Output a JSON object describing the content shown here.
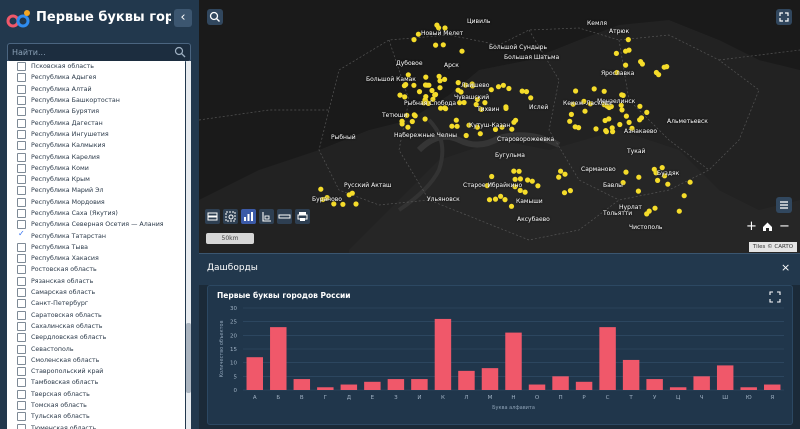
{
  "sidebar": {
    "title": "Первые буквы городо...",
    "search_placeholder": "Найти...",
    "items": [
      {
        "label": "Псковская область",
        "checked": false
      },
      {
        "label": "Республика Адыгея",
        "checked": false
      },
      {
        "label": "Республика Алтай",
        "checked": false
      },
      {
        "label": "Республика Башкортостан",
        "checked": false
      },
      {
        "label": "Республика Бурятия",
        "checked": false
      },
      {
        "label": "Республика Дагестан",
        "checked": false
      },
      {
        "label": "Республика Ингушетия",
        "checked": false
      },
      {
        "label": "Республика Калмыкия",
        "checked": false
      },
      {
        "label": "Республика Карелия",
        "checked": false
      },
      {
        "label": "Республика Коми",
        "checked": false
      },
      {
        "label": "Республика Крым",
        "checked": false
      },
      {
        "label": "Республика Марий Эл",
        "checked": false
      },
      {
        "label": "Республика Мордовия",
        "checked": false
      },
      {
        "label": "Республика Саха (Якутия)",
        "checked": false
      },
      {
        "label": "Республика Северная Осетия — Алания",
        "checked": false
      },
      {
        "label": "Республика Татарстан",
        "checked": true
      },
      {
        "label": "Республика Тыва",
        "checked": false
      },
      {
        "label": "Республика Хакасия",
        "checked": false
      },
      {
        "label": "Ростовская область",
        "checked": false
      },
      {
        "label": "Рязанская область",
        "checked": false
      },
      {
        "label": "Самарская область",
        "checked": false
      },
      {
        "label": "Санкт-Петербург",
        "checked": false
      },
      {
        "label": "Саратовская область",
        "checked": false
      },
      {
        "label": "Сахалинская область",
        "checked": false
      },
      {
        "label": "Свердловская область",
        "checked": false
      },
      {
        "label": "Севастополь",
        "checked": false
      },
      {
        "label": "Смоленская область",
        "checked": false
      },
      {
        "label": "Ставропольский край",
        "checked": false
      },
      {
        "label": "Тамбовская область",
        "checked": false
      },
      {
        "label": "Тверская область",
        "checked": false
      },
      {
        "label": "Томская область",
        "checked": false
      },
      {
        "label": "Тульская область",
        "checked": false
      },
      {
        "label": "Тюменская область",
        "checked": false
      }
    ]
  },
  "map": {
    "scale_label": "50km",
    "attribution": "Tiles © CARTO",
    "point_color": "#f5dc2a",
    "cities": [
      "Цивиль",
      "Новый Мелет",
      "Кемля",
      "Большой Сундырь",
      "Большая Шатьма",
      "Атрюк",
      "Дубовое",
      "Ярославка",
      "Большой Камак",
      "Арск",
      "Лаишево",
      "Чувашский",
      "Рыбная Слобода",
      "Тетюши",
      "Тихвин",
      "Ислей",
      "Кутуш-Казан",
      "Кекеж-Ласкова",
      "Мензелинск",
      "Рыбный",
      "Набережные Челны",
      "Азнакаево",
      "Альметьевск",
      "Староворожеевка",
      "Бугульма",
      "Тукай",
      "Сарманово",
      "Буздяк",
      "Русский Акташ",
      "Бавлы",
      "Старое Ибрайкино",
      "Камыши",
      "Тольятти",
      "Бураново",
      "Аксубаево",
      "Ульяновск",
      "Чистополь",
      "Нурлат"
    ],
    "tools_icons": [
      "layers-icon",
      "select-icon",
      "chart-icon",
      "filter-icon",
      "ruler-icon",
      "print-icon"
    ],
    "icons": {
      "search": "search-icon",
      "fullscreen": "fullscreen-icon",
      "list": "list-icon",
      "zoom_in": "plus-icon",
      "home": "home-icon",
      "zoom_out": "minus-icon"
    }
  },
  "dashboard": {
    "header_title": "Дашборды",
    "close_label": "×",
    "bar_color": "#f0586a"
  },
  "chart_data": {
    "type": "bar",
    "title": "Первые буквы городов России",
    "xlabel": "Буква алфавита",
    "ylabel": "Количество объектов",
    "ylim": [
      0,
      30
    ],
    "yticks": [
      0,
      5,
      10,
      15,
      20,
      25,
      30
    ],
    "grid": true,
    "categories": [
      "А",
      "Б",
      "В",
      "Г",
      "Д",
      "Е",
      "З",
      "И",
      "К",
      "Л",
      "М",
      "Н",
      "О",
      "П",
      "Р",
      "С",
      "Т",
      "У",
      "Ц",
      "Ч",
      "Ш",
      "Ю",
      "Я"
    ],
    "values": [
      12,
      23,
      4,
      1,
      2,
      3,
      4,
      4,
      26,
      7,
      8,
      21,
      2,
      5,
      3,
      23,
      11,
      4,
      1,
      5,
      9,
      1,
      2
    ]
  }
}
